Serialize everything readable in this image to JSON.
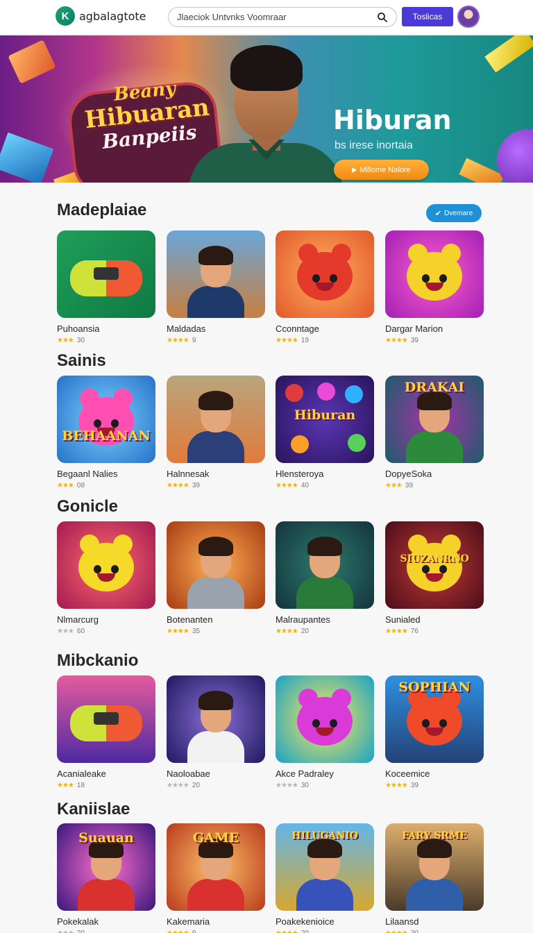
{
  "header": {
    "logo_text": "agbalagtote",
    "search_text": "Jlaeciok   Untvnks   Voomraar",
    "top_button_label": "Toslicas"
  },
  "banner": {
    "game_title_line1": "Beany",
    "game_title_line2": "Hibuaran",
    "game_title_line3": "Banpeiis",
    "hero_title": "Hiburan",
    "hero_subtitle": "bs irese inortaia",
    "hero_button_label": "Millome Nalore"
  },
  "more_button_label": "Dvernare",
  "sections": [
    {
      "title": "Madeplaiae",
      "items": [
        {
          "title": "Puhoansia",
          "rating": "30",
          "stars": "★★★",
          "grey": false
        },
        {
          "title": "Maldadas",
          "rating": "9",
          "stars": "★★★★",
          "grey": false
        },
        {
          "title": "Cconntage",
          "rating": "19",
          "stars": "★★★★",
          "grey": false
        },
        {
          "title": "Dargar Marion",
          "rating": "39",
          "stars": "★★★★",
          "grey": false
        }
      ]
    },
    {
      "title": "Sainis",
      "items": [
        {
          "title": "Begaanl Nalies",
          "rating": "08",
          "stars": "★★★",
          "grey": false
        },
        {
          "title": "Halnnesak",
          "rating": "39",
          "stars": "★★★★",
          "grey": false
        },
        {
          "title": "Hlensteroya",
          "rating": "40",
          "stars": "★★★★",
          "grey": false
        },
        {
          "title": "DopyeSoka",
          "rating": "39",
          "stars": "★★★",
          "grey": false
        }
      ]
    },
    {
      "title": "Gonicle",
      "items": [
        {
          "title": "Nlmarcurg",
          "rating": "60",
          "stars": "★★★",
          "grey": true
        },
        {
          "title": "Botenanten",
          "rating": "35",
          "stars": "★★★★",
          "grey": false
        },
        {
          "title": "Malraupantes",
          "rating": "20",
          "stars": "★★★★",
          "grey": false
        },
        {
          "title": "Sunialed",
          "rating": "76",
          "stars": "★★★★",
          "grey": false
        }
      ]
    },
    {
      "title": "Mibckanio",
      "items": [
        {
          "title": "Acanialeake",
          "rating": "18",
          "stars": "★★★",
          "grey": false
        },
        {
          "title": "Naoloabae",
          "rating": "20",
          "stars": "★★★★",
          "grey": true
        },
        {
          "title": "Akce Padraley",
          "rating": "30",
          "stars": "★★★★",
          "grey": true
        },
        {
          "title": "Koceemice",
          "rating": "39",
          "stars": "★★★★",
          "grey": false
        }
      ]
    },
    {
      "title": "Kaniislae",
      "items": [
        {
          "title": "Pokekalak",
          "rating": "20",
          "stars": "★★★",
          "grey": true
        },
        {
          "title": "Kakemaria",
          "rating": "9",
          "stars": "★★★★",
          "grey": false
        },
        {
          "title": "Poakekenioice",
          "rating": "20",
          "stars": "★★★★",
          "grey": false
        },
        {
          "title": "Lilaansd",
          "rating": "30",
          "stars": "★★★★",
          "grey": false
        }
      ]
    }
  ],
  "thumb_words": {
    "s1_i0": "",
    "s1_i1": "",
    "s1_i2": "",
    "s1_i3": "",
    "s2_i0": "BEHAANAN",
    "s2_i1": "",
    "s2_i2": "Hiburan",
    "s2_i3": "DRAKAI",
    "s3_i0": "",
    "s3_i1": "",
    "s3_i2": "",
    "s3_i3": "SIUZANRNO",
    "s4_i0": "",
    "s4_i1": "",
    "s4_i2": "",
    "s4_i3": "SOPHIAN",
    "s5_i0": "Suauan",
    "s5_i1": "GAME",
    "s5_i2": "HILUGANIO",
    "s5_i3": "FARY SRME"
  },
  "colors": {
    "accent": "#4c3ad6",
    "more_button": "#1f8fd6",
    "hero_button": "#f29a1f",
    "star": "#f4b400"
  }
}
